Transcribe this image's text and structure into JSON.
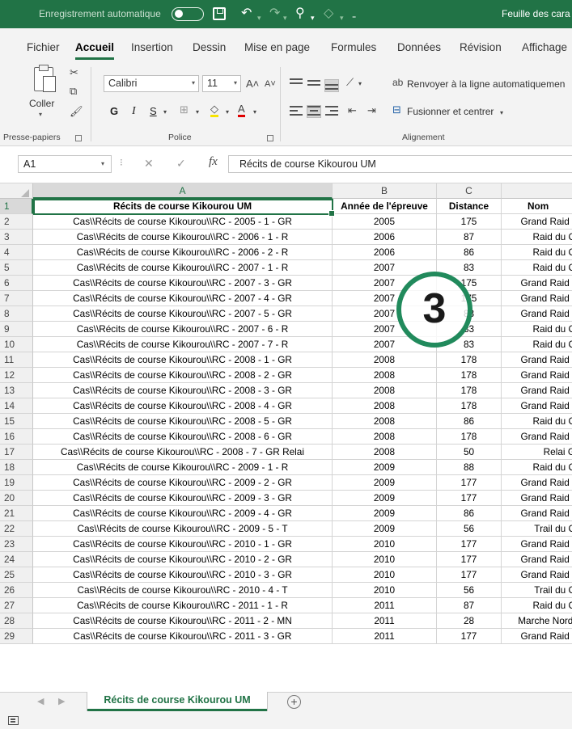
{
  "titlebar": {
    "autosave_label": "Enregistrement automatique",
    "autosave_state": "off",
    "window_title": "Feuille des cara",
    "accent_color": "#217346"
  },
  "menu": {
    "items": [
      "Fichier",
      "Accueil",
      "Insertion",
      "Dessin",
      "Mise en page",
      "Formules",
      "Données",
      "Révision",
      "Affichage"
    ],
    "active": "Accueil"
  },
  "ribbon": {
    "paste_label": "Coller",
    "font_name": "Calibri",
    "font_size": "11",
    "bold": "G",
    "italic": "I",
    "underline": "S",
    "wrap_text": "Renvoyer à la ligne automatiquemen",
    "merge_center": "Fusionner et centrer",
    "groups": {
      "clipboard": "Presse-papiers",
      "font": "Police",
      "alignment": "Alignement"
    }
  },
  "formula_bar": {
    "name_box": "A1",
    "fx": "fx",
    "content": "Récits de course Kikourou UM"
  },
  "grid": {
    "columns": [
      "A",
      "B",
      "C",
      ""
    ],
    "headers": [
      "Récits de course Kikourou UM",
      "Année de l'épreuve",
      "Distance",
      "Nom"
    ],
    "rows": [
      [
        "2",
        "Cas\\\\Récits de course Kikourou\\\\RC - 2005 - 1 - GR",
        "2005",
        "175",
        "Grand Raid ("
      ],
      [
        "3",
        "Cas\\\\Récits de course Kikourou\\\\RC - 2006 - 1 - R",
        "2006",
        "87",
        "Raid du C"
      ],
      [
        "4",
        "Cas\\\\Récits de course Kikourou\\\\RC - 2006 - 2 - R",
        "2006",
        "86",
        "Raid du C"
      ],
      [
        "5",
        "Cas\\\\Récits de course Kikourou\\\\RC - 2007 - 1 - R",
        "2007",
        "83",
        "Raid du C"
      ],
      [
        "6",
        "Cas\\\\Récits de course Kikourou\\\\RC - 2007 - 3 - GR",
        "2007",
        "175",
        "Grand Raid ("
      ],
      [
        "7",
        "Cas\\\\Récits de course Kikourou\\\\RC - 2007 - 4 - GR",
        "2007",
        "175",
        "Grand Raid ("
      ],
      [
        "8",
        "Cas\\\\Récits de course Kikourou\\\\RC - 2007 - 5 - GR",
        "2007",
        "83",
        "Grand Raid ("
      ],
      [
        "9",
        "Cas\\\\Récits de course Kikourou\\\\RC - 2007 - 6 - R",
        "2007",
        "83",
        "Raid du C"
      ],
      [
        "10",
        "Cas\\\\Récits de course Kikourou\\\\RC - 2007 - 7 - R",
        "2007",
        "83",
        "Raid du C"
      ],
      [
        "11",
        "Cas\\\\Récits de course Kikourou\\\\RC - 2008 - 1 - GR",
        "2008",
        "178",
        "Grand Raid ("
      ],
      [
        "12",
        "Cas\\\\Récits de course Kikourou\\\\RC - 2008 - 2 - GR",
        "2008",
        "178",
        "Grand Raid ("
      ],
      [
        "13",
        "Cas\\\\Récits de course Kikourou\\\\RC - 2008 - 3 - GR",
        "2008",
        "178",
        "Grand Raid ("
      ],
      [
        "14",
        "Cas\\\\Récits de course Kikourou\\\\RC - 2008 - 4 - GR",
        "2008",
        "178",
        "Grand Raid ("
      ],
      [
        "15",
        "Cas\\\\Récits de course Kikourou\\\\RC - 2008 - 5 - GR",
        "2008",
        "86",
        "Raid du C"
      ],
      [
        "16",
        "Cas\\\\Récits de course Kikourou\\\\RC - 2008 - 6 - GR",
        "2008",
        "178",
        "Grand Raid ("
      ],
      [
        "17",
        "Cas\\\\Récits de course Kikourou\\\\RC - 2008 - 7 - GR Relai",
        "2008",
        "50",
        "Relai G"
      ],
      [
        "18",
        "Cas\\\\Récits de course Kikourou\\\\RC - 2009 - 1 - R",
        "2009",
        "88",
        "Raid du C"
      ],
      [
        "19",
        "Cas\\\\Récits de course Kikourou\\\\RC - 2009 - 2 - GR",
        "2009",
        "177",
        "Grand Raid ("
      ],
      [
        "20",
        "Cas\\\\Récits de course Kikourou\\\\RC - 2009 - 3 - GR",
        "2009",
        "177",
        "Grand Raid ("
      ],
      [
        "21",
        "Cas\\\\Récits de course Kikourou\\\\RC - 2009 - 4 - GR",
        "2009",
        "86",
        "Grand Raid ("
      ],
      [
        "22",
        "Cas\\\\Récits de course Kikourou\\\\RC - 2009 - 5 - T",
        "2009",
        "56",
        "Trail du C"
      ],
      [
        "23",
        "Cas\\\\Récits de course Kikourou\\\\RC - 2010 - 1 - GR",
        "2010",
        "177",
        "Grand Raid ("
      ],
      [
        "24",
        "Cas\\\\Récits de course Kikourou\\\\RC - 2010 - 2 - GR",
        "2010",
        "177",
        "Grand Raid ("
      ],
      [
        "25",
        "Cas\\\\Récits de course Kikourou\\\\RC - 2010 - 3 - GR",
        "2010",
        "177",
        "Grand Raid ("
      ],
      [
        "26",
        "Cas\\\\Récits de course Kikourou\\\\RC - 2010 - 4 - T",
        "2010",
        "56",
        "Trail du C"
      ],
      [
        "27",
        "Cas\\\\Récits de course Kikourou\\\\RC - 2011 - 1 - R",
        "2011",
        "87",
        "Raid du C"
      ],
      [
        "28",
        "Cas\\\\Récits de course Kikourou\\\\RC - 2011 - 2 - MN",
        "2011",
        "28",
        "Marche Nordi"
      ],
      [
        "29",
        "Cas\\\\Récits de course Kikourou\\\\RC - 2011 - 3 - GR",
        "2011",
        "177",
        "Grand Raid ("
      ]
    ]
  },
  "badge": {
    "number": "3",
    "color": "#218a5c"
  },
  "sheets": {
    "tabs": [
      "Récits de course Kikourou UM"
    ],
    "add_label": "+"
  }
}
